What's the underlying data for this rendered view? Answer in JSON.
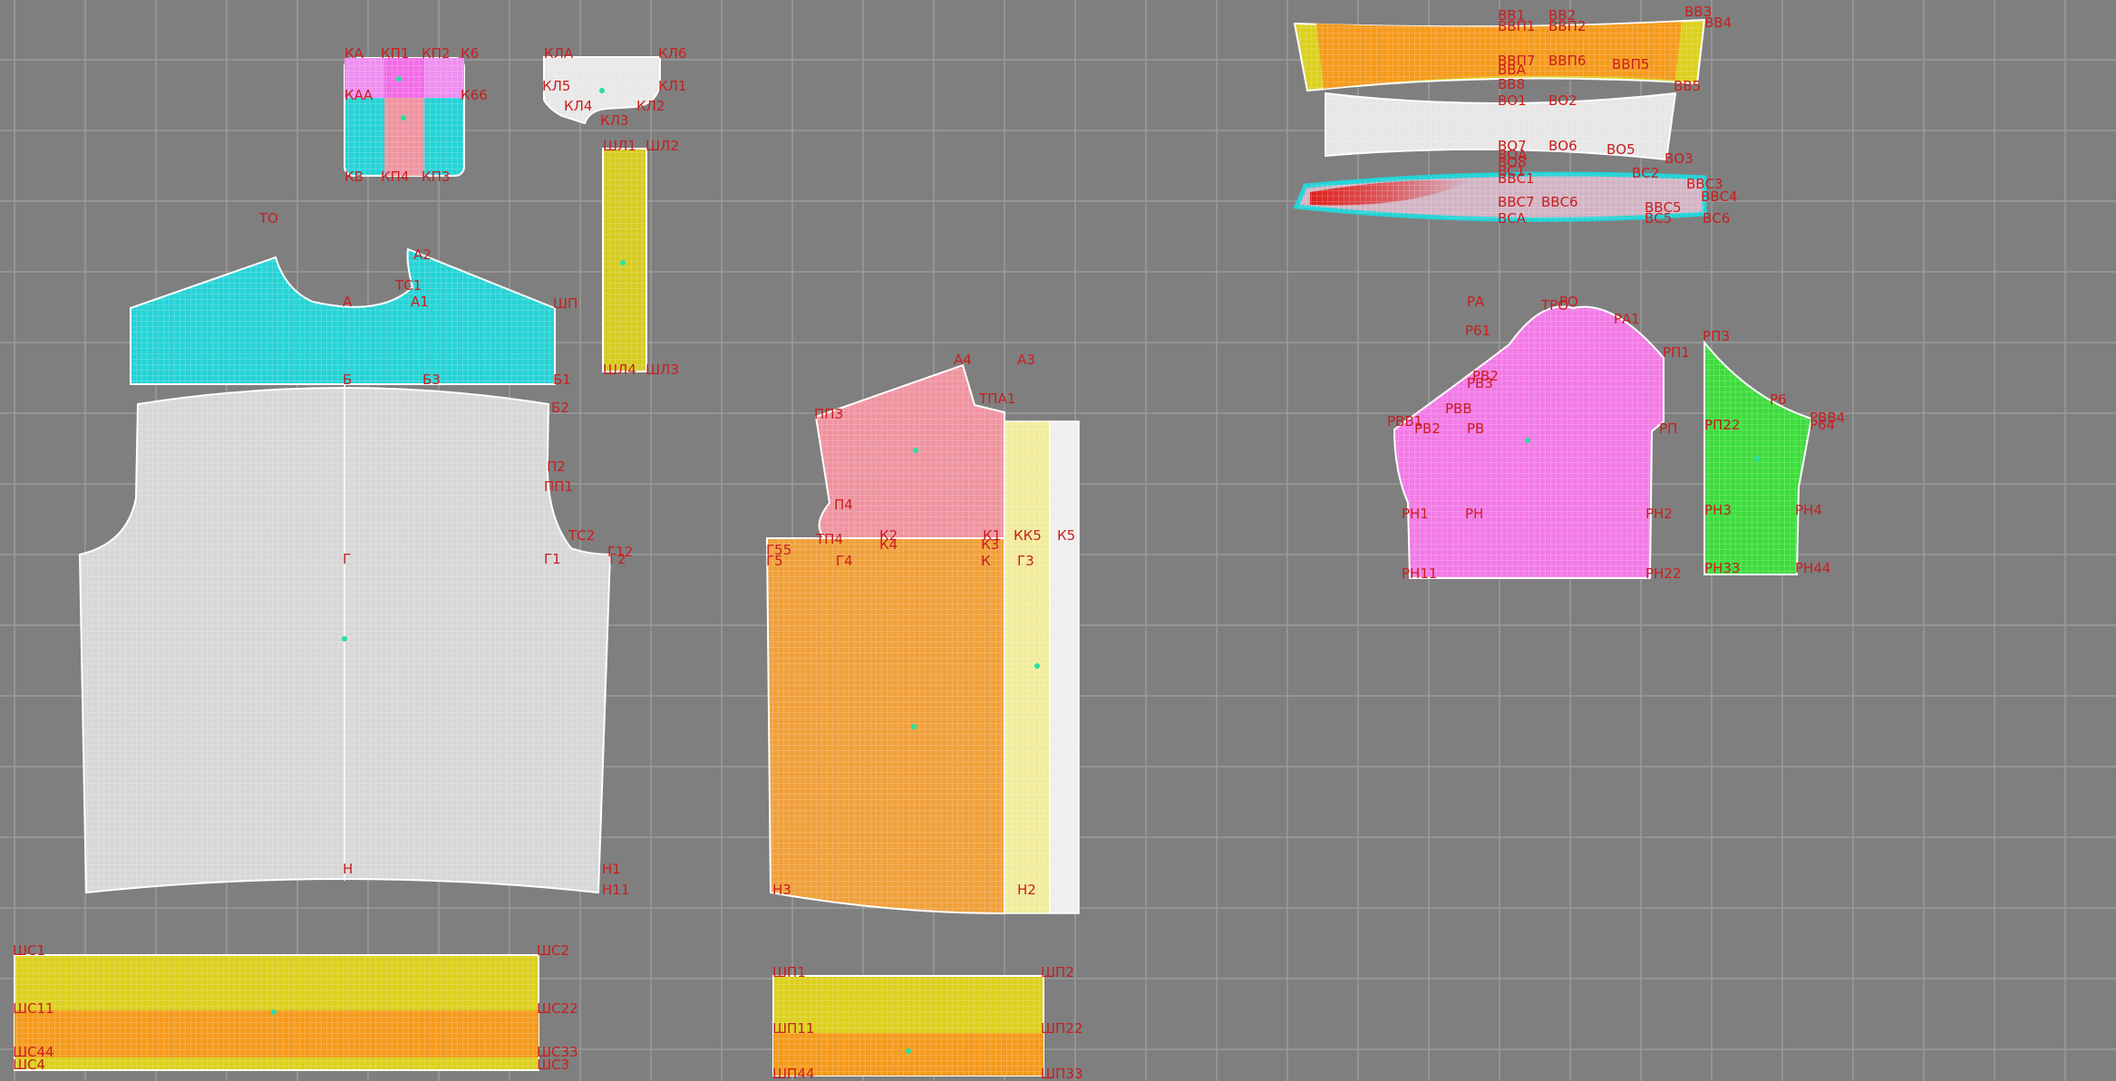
{
  "colors": {
    "background": "#7f7f7f",
    "grid": "#9b9b9b",
    "label": "#c81e1e",
    "outline": "#ffffff",
    "cyan": "#26d3d6",
    "grey_piece": "#d7d7d7",
    "yellow": "#dcd01e",
    "orange": "#f59a1c",
    "pink": "#ee94a0",
    "magenta": "#f27ae6",
    "green": "#3ddc3d",
    "light_yellow": "#f1ec9c",
    "white_piece": "#eeeeee",
    "red_mark": "#e0201c"
  },
  "pieces": [
    {
      "name": "pocket-piece"
    },
    {
      "name": "collar-stand-piece"
    },
    {
      "name": "collar-strip-piece"
    },
    {
      "name": "yoke-piece"
    },
    {
      "name": "back-piece"
    },
    {
      "name": "front-piece"
    },
    {
      "name": "cuff-left-piece"
    },
    {
      "name": "cuff-right-piece"
    },
    {
      "name": "waistband-top-piece"
    },
    {
      "name": "waistband-mid-piece"
    },
    {
      "name": "waistband-bottom-piece"
    },
    {
      "name": "sleeve-piece"
    },
    {
      "name": "sleeve-placket-piece"
    }
  ],
  "labels": [
    "КА",
    "КП1",
    "КП2",
    "К6",
    "КАА",
    "К66",
    "КВ",
    "КП4",
    "КП3",
    "КЛА",
    "КЛ6",
    "КЛ5",
    "КЛ1",
    "КЛ4",
    "КЛ2",
    "КЛ3",
    "ШЛ1",
    "ШЛ2",
    "ШЛ4",
    "ШЛ3",
    "ТО",
    "А2",
    "ТС1",
    "А1",
    "А",
    "ШП",
    "Б",
    "Б3",
    "Б1",
    "Б2",
    "П2",
    "ПП1",
    "ТС2",
    "Г",
    "Г1",
    "Г2",
    "Г12",
    "Н",
    "Н1",
    "Н11",
    "А4",
    "А3",
    "ППЗ",
    "ТПА1",
    "П4",
    "Г55",
    "Г5",
    "ТП4",
    "Г4",
    "К2",
    "К4",
    "К1",
    "КК5",
    "К3",
    "К5",
    "К",
    "Г3",
    "Н3",
    "Н2",
    "ШС1",
    "ШС2",
    "ШС11",
    "ШС22",
    "ШС44",
    "ШС33",
    "ШС4",
    "ШС3",
    "ШП1",
    "ШП2",
    "ШП11",
    "ШП22",
    "ШП44",
    "ШП33",
    "ВВ1",
    "ВВ2",
    "ВВЗ",
    "ВВ4",
    "ВВП1",
    "ВВП2",
    "ВВП7",
    "ВВП6",
    "ВВП5",
    "ВВ8",
    "ВВА",
    "ВВ5",
    "ВО1",
    "ВО2",
    "ВО7",
    "ВО6",
    "ВО5",
    "ВО8",
    "ВОА",
    "ВС1",
    "ВВС1",
    "ВС2",
    "ВО3",
    "ВВС3",
    "ВВС4",
    "ВВС7",
    "ВВС6",
    "ВВС5",
    "ВС5",
    "ВСА",
    "ВС6",
    "РА",
    "ТРО",
    "РО",
    "РА1",
    "Р61",
    "РП1",
    "РВ2",
    "РВ3",
    "РВВ",
    "РВВ1",
    "РВ2",
    "РВ",
    "РП",
    "РП2",
    "РН1",
    "РН",
    "РН2",
    "РН11",
    "РН22",
    "РПЗ",
    "Р6",
    "РВВ4",
    "Р64",
    "РП22",
    "РН3",
    "РН4",
    "РН33",
    "РН44"
  ]
}
